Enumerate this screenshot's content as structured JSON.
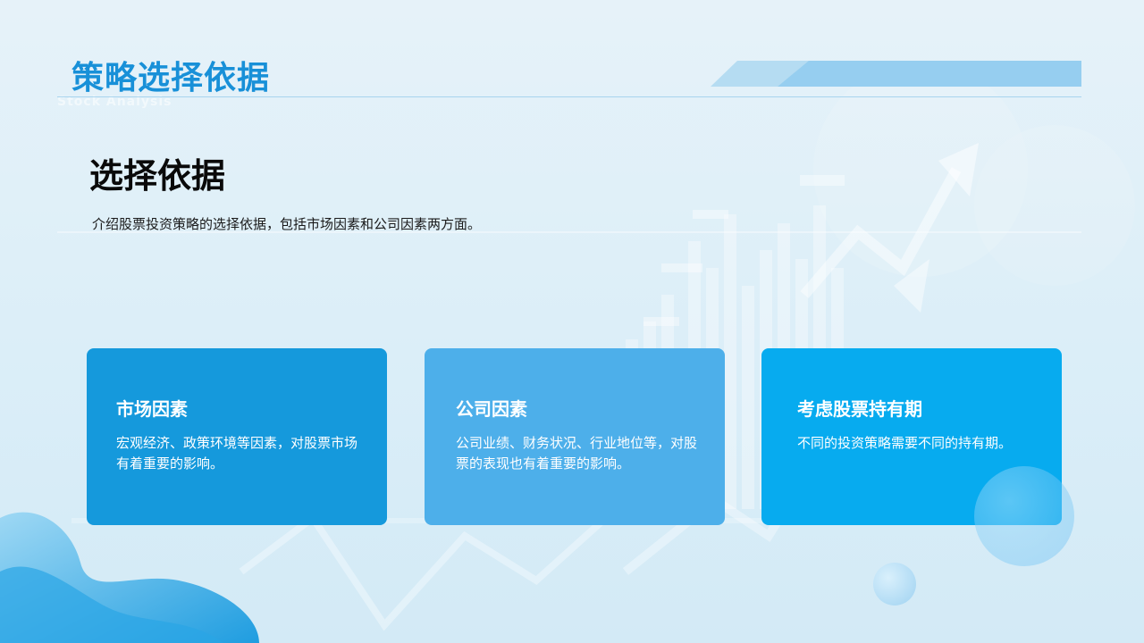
{
  "header": {
    "title": "策略选择依据",
    "subtitle": "Stock Analysis"
  },
  "section": {
    "heading": "选择依据",
    "intro": "介绍股票投资策略的选择依据，包括市场因素和公司因素两方面。"
  },
  "cards": [
    {
      "title": "市场因素",
      "text": "宏观经济、政策环境等因素，对股票市场有着重要的影响。"
    },
    {
      "title": "公司因素",
      "text": "公司业绩、财务状况、行业地位等，对股票的表现也有着重要的影响。"
    },
    {
      "title": "考虑股票持有期",
      "text": "不同的投资策略需要不同的持有期。"
    }
  ],
  "colors": {
    "title": "#1890d8",
    "card_1": "#1599dc",
    "card_2": "#4dafea",
    "card_3": "#07abef"
  }
}
